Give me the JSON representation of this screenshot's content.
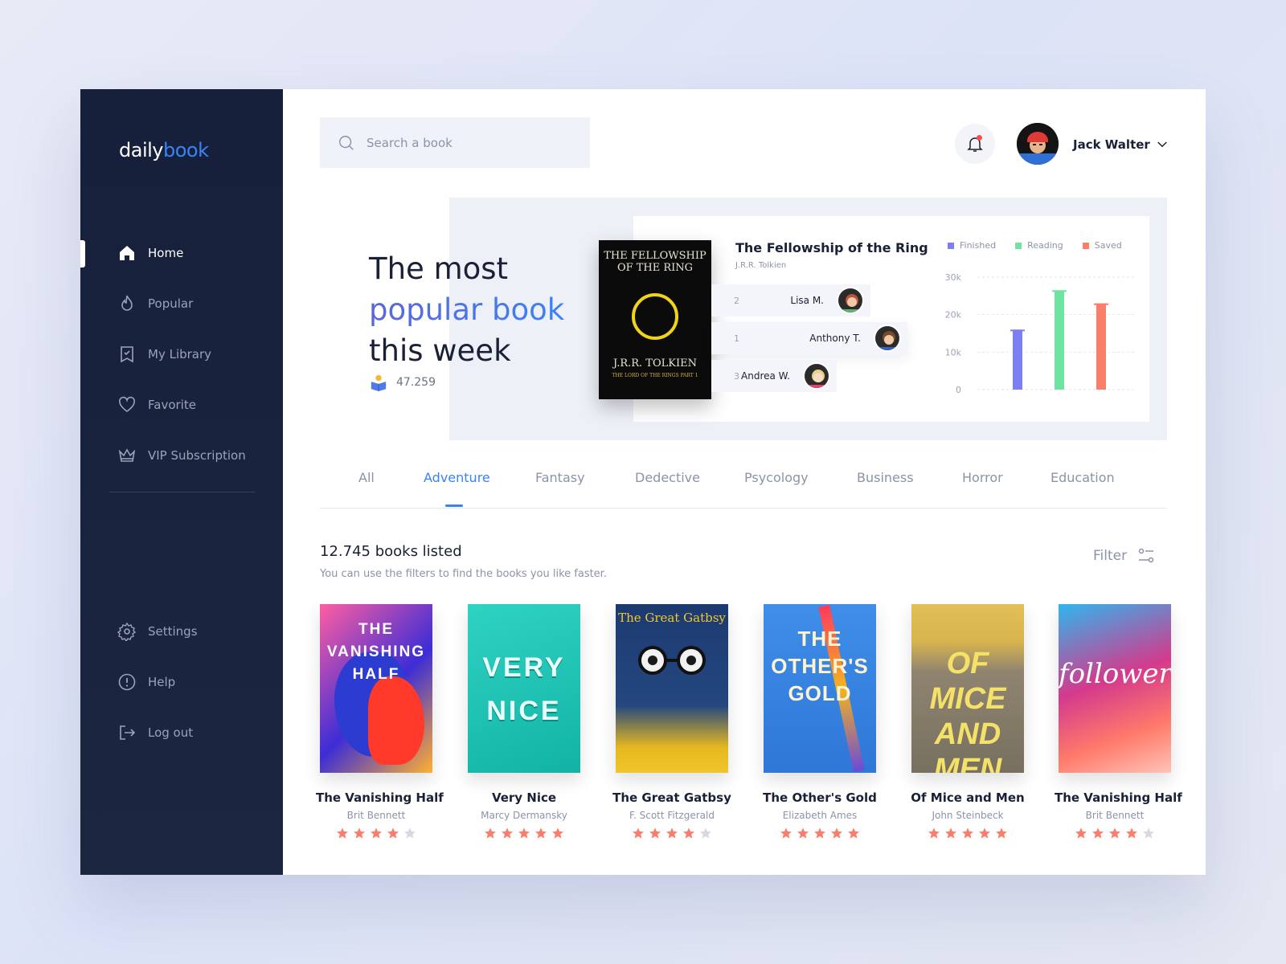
{
  "app": {
    "logo_daily": "daily",
    "logo_book": "book"
  },
  "sidebar": {
    "items": [
      {
        "label": "Home",
        "icon": "home-icon",
        "active": true
      },
      {
        "label": "Popular",
        "icon": "flame-icon"
      },
      {
        "label": "My Library",
        "icon": "bookmark-icon"
      },
      {
        "label": "Favorite",
        "icon": "heart-icon"
      },
      {
        "label": "VIP Subscription",
        "icon": "crown-icon"
      }
    ],
    "bottom": [
      {
        "label": "Settings",
        "icon": "gear-icon"
      },
      {
        "label": "Help",
        "icon": "help-icon"
      },
      {
        "label": "Log out",
        "icon": "logout-icon"
      }
    ]
  },
  "header": {
    "search_placeholder": "Search a book",
    "user_name": "Jack Walter"
  },
  "hero": {
    "line1": "The most",
    "line2": "popular book",
    "line3": "this week",
    "readers": "47.259",
    "cover_title": "THE FELLOWSHIP OF THE RING",
    "cover_author": "J.R.R. TOLKIEN",
    "cover_sub": "THE LORD OF THE RINGS PART 1",
    "book_title": "The Fellowship of the Ring",
    "book_author": "J.R.R. Tolkien",
    "ranking": [
      {
        "rank": "2",
        "name": "Lisa M."
      },
      {
        "rank": "1",
        "name": "Anthony T."
      },
      {
        "rank": "3",
        "name": "Andrea W."
      }
    ]
  },
  "chart_data": {
    "type": "bar",
    "categories": [
      "Finished",
      "Reading",
      "Saved"
    ],
    "values": [
      16000,
      26500,
      23000
    ],
    "ylim": [
      0,
      30000
    ],
    "yticks": [
      "30k",
      "20k",
      "10k",
      "0"
    ],
    "colors": [
      "#7b7ff2",
      "#6ee3a2",
      "#fb7e6b"
    ],
    "legend": [
      "Finished",
      "Reading",
      "Saved"
    ],
    "legend_position": "top-right"
  },
  "tabs": [
    "All",
    "Adventure",
    "Fantasy",
    "Dedective",
    "Psycology",
    "Business",
    "Horror",
    "Education"
  ],
  "list": {
    "count": "12.745 books listed",
    "subtitle": "You can use the filters to find the books you like faster.",
    "filter": "Filter"
  },
  "books": [
    {
      "title": "The Vanishing Half",
      "author": "Brit Bennett",
      "rating": 4,
      "cover": "THE VANISHING HALF"
    },
    {
      "title": "Very Nice",
      "author": "Marcy Dermansky",
      "rating": 5,
      "cover": "VERY NICE"
    },
    {
      "title": "The Great Gatbsy",
      "author": "F. Scott Fitzgerald",
      "rating": 4,
      "cover": "The Great Gatbsy"
    },
    {
      "title": "The Other's Gold",
      "author": "Elizabeth Ames",
      "rating": 5,
      "cover": "THE OTHER'S GOLD"
    },
    {
      "title": "Of Mice and Men",
      "author": "John Steinbeck",
      "rating": 5,
      "cover": "OF MICE AND MEN"
    },
    {
      "title": "The Vanishing Half",
      "author": "Brit Bennett",
      "rating": 4,
      "cover": "followers"
    }
  ],
  "colors": {
    "accent": "#3b82f6",
    "star": "#fb7e6b",
    "sidebar": "#16203a"
  }
}
